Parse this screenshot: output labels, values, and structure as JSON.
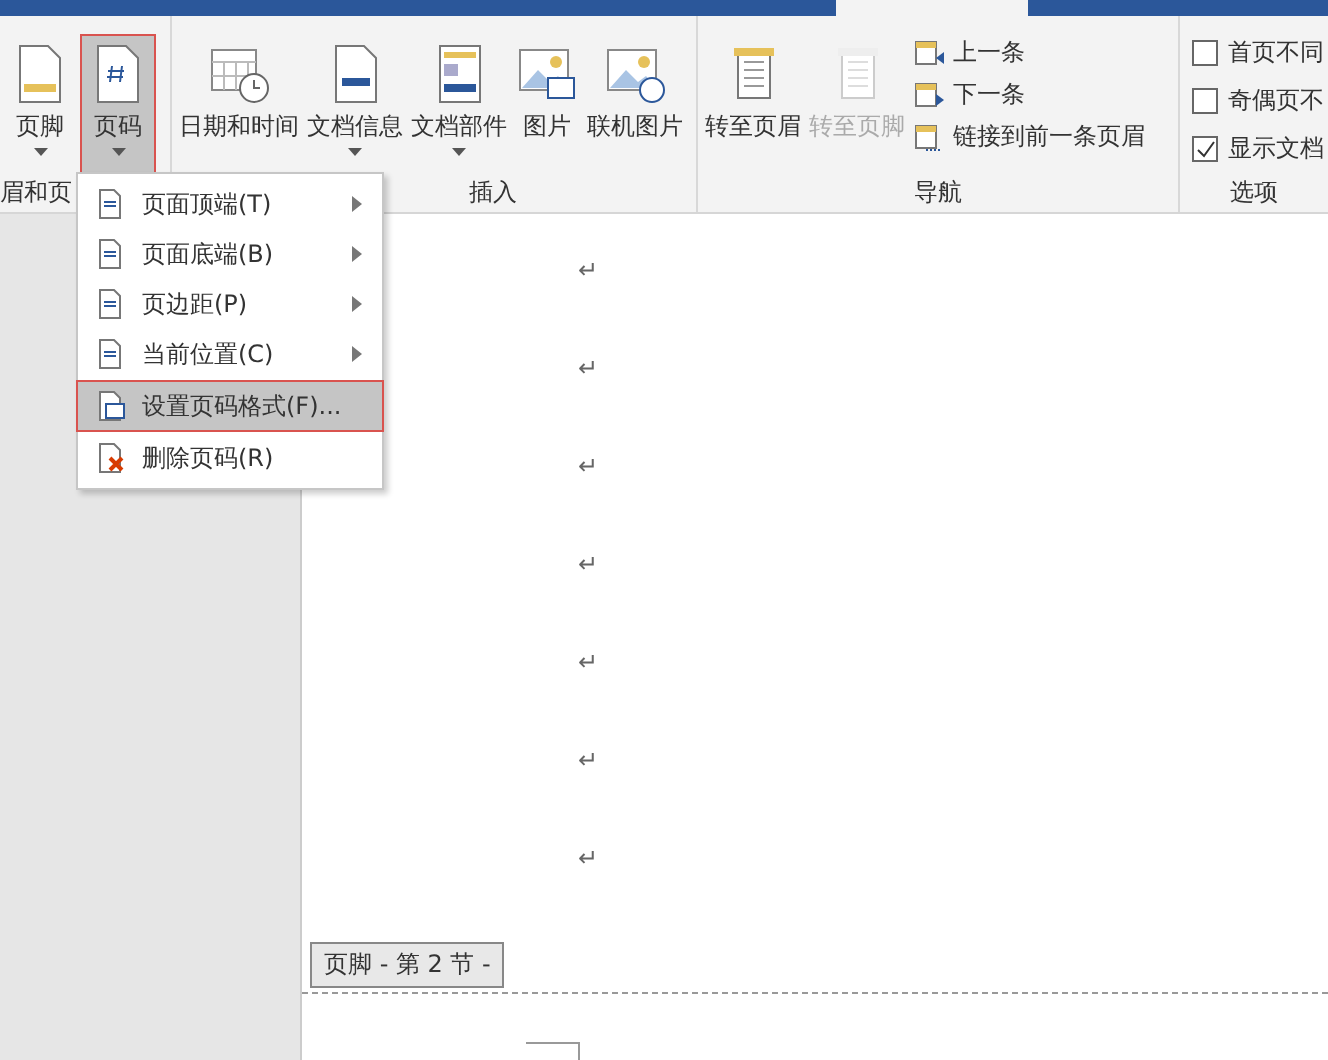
{
  "ribbon": {
    "groups": [
      {
        "label": "眉和页",
        "buttons": [
          {
            "label": "页脚",
            "kind": "footer",
            "dropdown": true,
            "selected": false,
            "disabled": false
          },
          {
            "label": "页码",
            "kind": "pagenum",
            "dropdown": true,
            "selected": true,
            "disabled": false
          }
        ]
      },
      {
        "label": "插入",
        "buttons": [
          {
            "label": "日期和时间",
            "kind": "calendar",
            "dropdown": false,
            "selected": false,
            "disabled": false
          },
          {
            "label": "文档信息",
            "kind": "docinfo",
            "dropdown": true,
            "selected": false,
            "disabled": false
          },
          {
            "label": "文档部件",
            "kind": "parts",
            "dropdown": true,
            "selected": false,
            "disabled": false
          },
          {
            "label": "图片",
            "kind": "picture",
            "dropdown": false,
            "selected": false,
            "disabled": false
          },
          {
            "label": "联机图片",
            "kind": "online",
            "dropdown": false,
            "selected": false,
            "disabled": false
          }
        ]
      },
      {
        "label": "导航",
        "buttons": [
          {
            "label": "转至页眉",
            "kind": "goto",
            "dropdown": false,
            "selected": false,
            "disabled": false
          },
          {
            "label": "转至页脚",
            "kind": "goto",
            "dropdown": false,
            "selected": false,
            "disabled": true
          }
        ],
        "small": [
          {
            "label": "上一条",
            "kind": "prev"
          },
          {
            "label": "下一条",
            "kind": "next"
          },
          {
            "label": "链接到前一条页眉",
            "kind": "link"
          }
        ]
      },
      {
        "label": "选项",
        "checks": [
          {
            "label": "首页不同",
            "checked": false
          },
          {
            "label": "奇偶页不",
            "checked": false
          },
          {
            "label": "显示文档",
            "checked": true
          }
        ]
      }
    ]
  },
  "menu": [
    {
      "label": "页面顶端(T)",
      "submenu": true,
      "selected": false,
      "kind": "page"
    },
    {
      "label": "页面底端(B)",
      "submenu": true,
      "selected": false,
      "kind": "page"
    },
    {
      "label": "页边距(P)",
      "submenu": true,
      "selected": false,
      "kind": "page"
    },
    {
      "label": "当前位置(C)",
      "submenu": true,
      "selected": false,
      "kind": "page"
    },
    {
      "label": "设置页码格式(F)...",
      "submenu": false,
      "selected": true,
      "kind": "format"
    },
    {
      "label": "删除页码(R)",
      "submenu": false,
      "selected": false,
      "kind": "delete"
    }
  ],
  "document": {
    "paragraph_marks": [
      "↵",
      "↵",
      "↵",
      "↵",
      "↵",
      "↵",
      "↵"
    ],
    "footer_tag": "页脚 - 第 2 节 -"
  }
}
